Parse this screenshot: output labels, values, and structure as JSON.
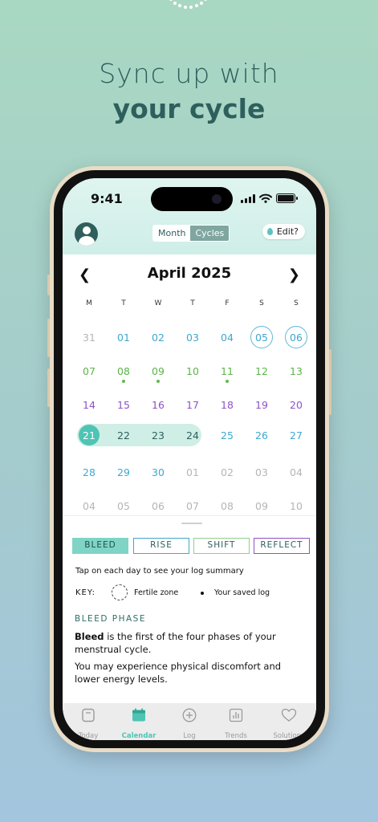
{
  "headline": {
    "line1": "Sync up with",
    "line2": "your cycle"
  },
  "status_bar": {
    "time": "9:41"
  },
  "header": {
    "view_toggle": {
      "month": "Month",
      "cycles": "Cycles",
      "selected": "Cycles"
    },
    "edit_label": "Edit?"
  },
  "calendar": {
    "month_title": "April 2025",
    "weekdays": [
      "M",
      "T",
      "W",
      "T",
      "F",
      "S",
      "S"
    ],
    "weeks": [
      [
        "31",
        "01",
        "02",
        "03",
        "04",
        "05",
        "06"
      ],
      [
        "07",
        "08",
        "09",
        "10",
        "11",
        "12",
        "13"
      ],
      [
        "14",
        "15",
        "16",
        "17",
        "18",
        "19",
        "20"
      ],
      [
        "21",
        "22",
        "23",
        "24",
        "25",
        "26",
        "27"
      ],
      [
        "28",
        "29",
        "30",
        "01",
        "02",
        "03",
        "04"
      ],
      [
        "04",
        "05",
        "06",
        "07",
        "08",
        "09",
        "10"
      ]
    ],
    "colors": {
      "muted": "#b5b5b5",
      "blue": "#3fa7cf",
      "green": "#5bb449",
      "purple": "#8d52c7",
      "teal_dark": "#2f5f5d",
      "teal": "#4ec4b4"
    }
  },
  "phases": {
    "buttons": [
      {
        "label": "BLEED",
        "selected": true,
        "color": "#4ec4b4"
      },
      {
        "label": "RISE",
        "selected": false,
        "color": "#3fa7cf"
      },
      {
        "label": "SHIFT",
        "selected": false,
        "color": "#8fd08a"
      },
      {
        "label": "REFLECT",
        "selected": false,
        "color": "#8d52c7"
      }
    ]
  },
  "info": {
    "tap_hint": "Tap on each day to see your log summary",
    "key_label": "KEY:",
    "fertile_zone": "Fertile zone",
    "saved_log": "Your saved log",
    "phase_title": "BLEED PHASE",
    "desc_bold": "Bleed",
    "desc_rest": " is the first of the four phases of your menstrual cycle.",
    "desc2": "You may experience physical discomfort and lower energy levels."
  },
  "tabbar": {
    "items": [
      {
        "label": "Today",
        "icon": "today-icon"
      },
      {
        "label": "Calendar",
        "icon": "calendar-icon",
        "active": true
      },
      {
        "label": "Log",
        "icon": "plus-circle-icon"
      },
      {
        "label": "Trends",
        "icon": "chart-icon"
      },
      {
        "label": "Solutions",
        "icon": "heart-icon"
      }
    ]
  }
}
